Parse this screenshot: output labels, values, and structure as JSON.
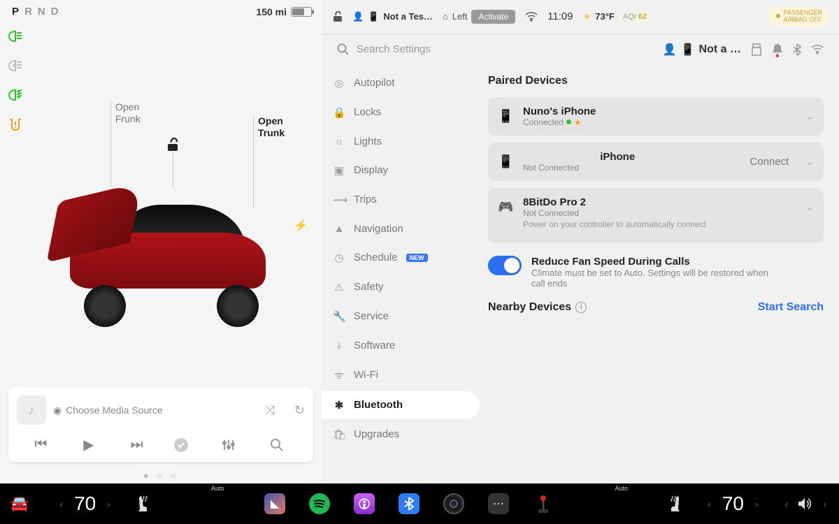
{
  "left": {
    "gear": {
      "p": "P",
      "r": "R",
      "n": "N",
      "d": "D",
      "active": "P"
    },
    "range": "150 mi",
    "callouts": {
      "open": "Open",
      "frunk": "Frunk",
      "trunk": "Trunk"
    },
    "media": {
      "source_placeholder": "Choose Media Source"
    }
  },
  "status": {
    "profile": "Not a Tes…",
    "homelink_side": "Left",
    "activate": "Activate",
    "clock": "11:09",
    "temp": "73°F",
    "aqi_label": "AQI",
    "aqi_value": "62",
    "airbag_line1": "PASSENGER",
    "airbag_line2": "AIRBAG",
    "airbag_off": "OFF"
  },
  "search": {
    "placeholder": "Search Settings",
    "profile_short": "Not a …"
  },
  "nav": {
    "autopilot": "Autopilot",
    "locks": "Locks",
    "lights": "Lights",
    "display": "Display",
    "trips": "Trips",
    "navigation": "Navigation",
    "schedule": "Schedule",
    "schedule_badge": "NEW",
    "safety": "Safety",
    "service": "Service",
    "software": "Software",
    "wifi": "Wi-Fi",
    "bluetooth": "Bluetooth",
    "upgrades": "Upgrades"
  },
  "bt": {
    "paired_title": "Paired Devices",
    "devices": [
      {
        "name": "Nuno's iPhone",
        "status": "Connected",
        "connected": true,
        "fav": true
      },
      {
        "name": "iPhone",
        "status": "Not Connected",
        "action": "Connect"
      },
      {
        "name": "8BitDo Pro 2",
        "status": "Not Connected",
        "hint": "Power on your controller to automatically connect"
      }
    ],
    "toggle": {
      "title": "Reduce Fan Speed During Calls",
      "sub": "Climate must be set to Auto. Settings will be restored when call ends"
    },
    "nearby_label": "Nearby Devices",
    "start_search": "Start Search"
  },
  "dock": {
    "temp_left": "70",
    "temp_right": "70",
    "auto": "Auto"
  }
}
